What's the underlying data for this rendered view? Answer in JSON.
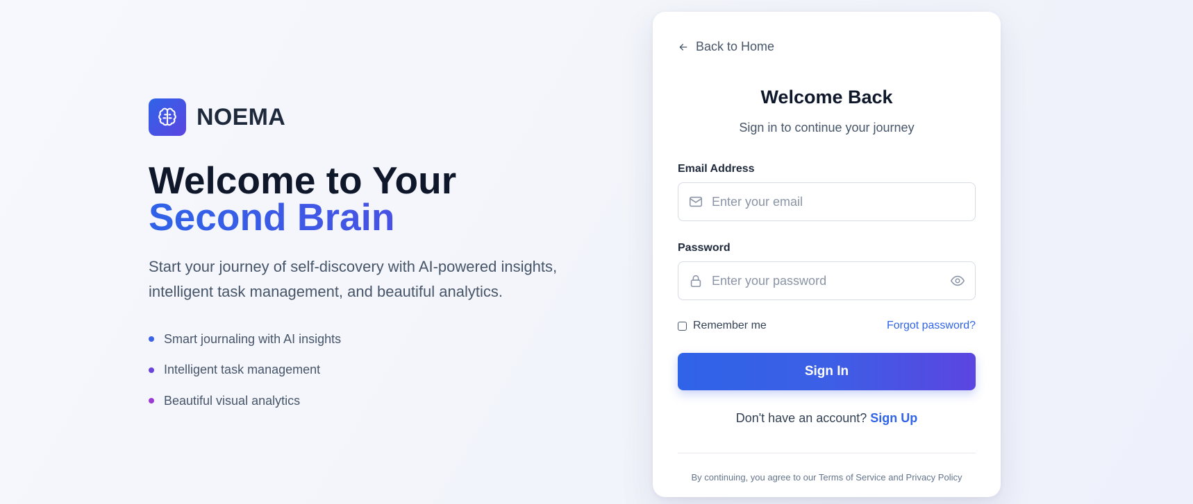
{
  "brand": {
    "name": "NOEMA",
    "logo_icon": "brain-icon",
    "accent_start": "#2f63e8",
    "accent_end": "#5b45e0"
  },
  "hero": {
    "headline_line1": "Welcome to Your",
    "headline_line2": "Second Brain",
    "description": "Start your journey of self-discovery with AI-powered insights, intelligent task management, and beautiful analytics.",
    "features": [
      {
        "label": "Smart journaling with AI insights",
        "color": "#3b63e6"
      },
      {
        "label": "Intelligent task management",
        "color": "#6a44d8"
      },
      {
        "label": "Beautiful visual analytics",
        "color": "#9b3bd4"
      }
    ]
  },
  "card": {
    "back_label": "Back to Home",
    "title": "Welcome Back",
    "subtitle": "Sign in to continue your journey",
    "email": {
      "label": "Email Address",
      "placeholder": "Enter your email",
      "value": "",
      "icon": "mail-icon"
    },
    "password": {
      "label": "Password",
      "placeholder": "Enter your password",
      "value": "",
      "icon": "lock-icon",
      "toggle_icon": "eye-icon"
    },
    "remember_label": "Remember me",
    "remember_checked": false,
    "forgot_label": "Forgot password?",
    "signin_label": "Sign In",
    "signup_prompt": "Don't have an account?",
    "signup_label": "Sign Up",
    "terms": "By continuing, you agree to our Terms of Service and Privacy Policy"
  }
}
